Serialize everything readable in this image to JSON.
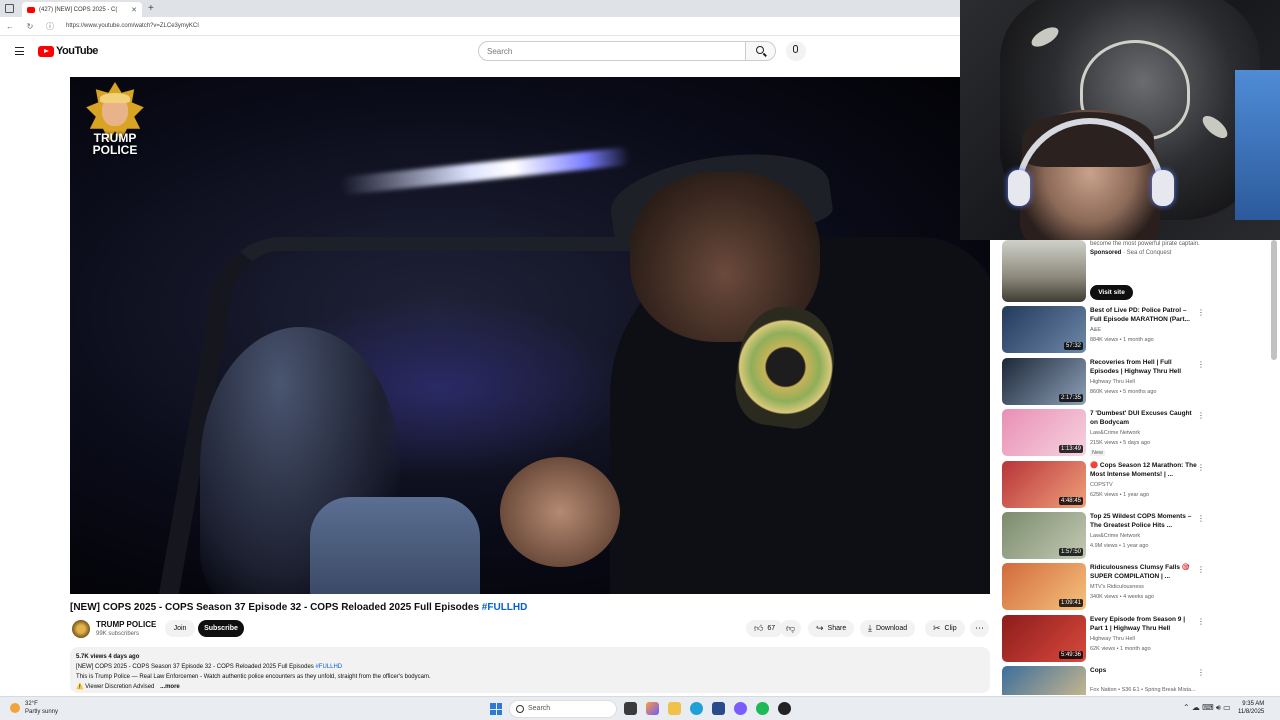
{
  "browser": {
    "tab_title": "(427) [NEW] COPS 2025 - C(",
    "url": "https://www.youtube.com/watch?v=ZLCe3ymyKCI"
  },
  "youtube": {
    "logo_text": "YouTube",
    "search_placeholder": "Search"
  },
  "video": {
    "overlay_logo_text": "TRUMP POLICE",
    "title": "[NEW] COPS 2025 - COPS Season 37 Episode 32 - COPS Reloaded 2025 Full Episodes",
    "title_tag": "#FULLHD"
  },
  "channel": {
    "name": "TRUMP POLICE",
    "subscribers": "99K subscribers",
    "join_label": "Join",
    "subscribe_label": "Subscribe"
  },
  "actions": {
    "likes": "67",
    "share_label": "Share",
    "download_label": "Download",
    "clip_label": "Clip"
  },
  "description": {
    "stats": "5.7K views  4 days ago",
    "line1": "[NEW] COPS 2025 - COPS Season 37 Episode 32 - COPS Reloaded 2025 Full Episodes",
    "line1_tag": "#FULLHD",
    "line2": "This is Trump Police — Real Law Enforcemen - Watch authentic police encounters as they unfold, straight from the officer's bodycam.",
    "line3": "⚠️ Viewer Discretion Advised",
    "more": "...more"
  },
  "sidebar": {
    "ad": {
      "text": "become the most powerful pirate captain.",
      "sponsored": "Sponsored",
      "advertiser": "· Sea of Conquest",
      "cta": "Visit site"
    },
    "items": [
      {
        "title": "Best of Live PD: Police Patrol – Full Episode MARATHON (Part...",
        "channel": "A&E",
        "meta": "884K views • 1 month ago",
        "duration": "57:32",
        "badge": ""
      },
      {
        "title": "Recoveries from Hell | Full Episodes | Highway Thru Hell",
        "channel": "Highway Thru Hell",
        "meta": "860K views • 5 months ago",
        "duration": "2:17:35",
        "badge": ""
      },
      {
        "title": "7 'Dumbest' DUI Excuses Caught on Bodycam",
        "channel": "Law&Crime Network",
        "meta": "215K views • 5 days ago",
        "duration": "1:13:49",
        "badge": "New"
      },
      {
        "title": "🔴 Cops Season 12 Marathon: The Most Intense Moments! | ...",
        "channel": "COPSTV",
        "meta": "625K views • 1 year ago",
        "duration": "4:48:45",
        "badge": ""
      },
      {
        "title": "Top 25 Wildest COPS Moments – The Greatest Police Hits ...",
        "channel": "Law&Crime Network",
        "meta": "4.9M views • 1 year ago",
        "duration": "1:57:50",
        "badge": ""
      },
      {
        "title": "Ridiculousness Clumsy Falls 🎯 SUPER COMPILATION | ...",
        "channel": "MTV's Ridiculousness",
        "meta": "340K views • 4 weeks ago",
        "duration": "1:09:41",
        "badge": ""
      },
      {
        "title": "Every Episode from Season 9 | Part 1 | Highway Thru Hell",
        "channel": "Highway Thru Hell",
        "meta": "62K views • 1 month ago",
        "duration": "5:49:36",
        "badge": ""
      },
      {
        "title": "Cops",
        "channel": "Fox Nation • S36 E1 • Spring Break Mista...",
        "meta": "",
        "duration": "",
        "badge": ""
      }
    ]
  },
  "taskbar": {
    "temp": "32°F",
    "condition": "Partly sunny",
    "search_label": "Search",
    "time": "9:35 AM",
    "date": "11/8/2025"
  },
  "colors": {
    "youtube_red": "#ff0000",
    "link_blue": "#065fd4",
    "subscribe_black": "#0f0f0f"
  }
}
